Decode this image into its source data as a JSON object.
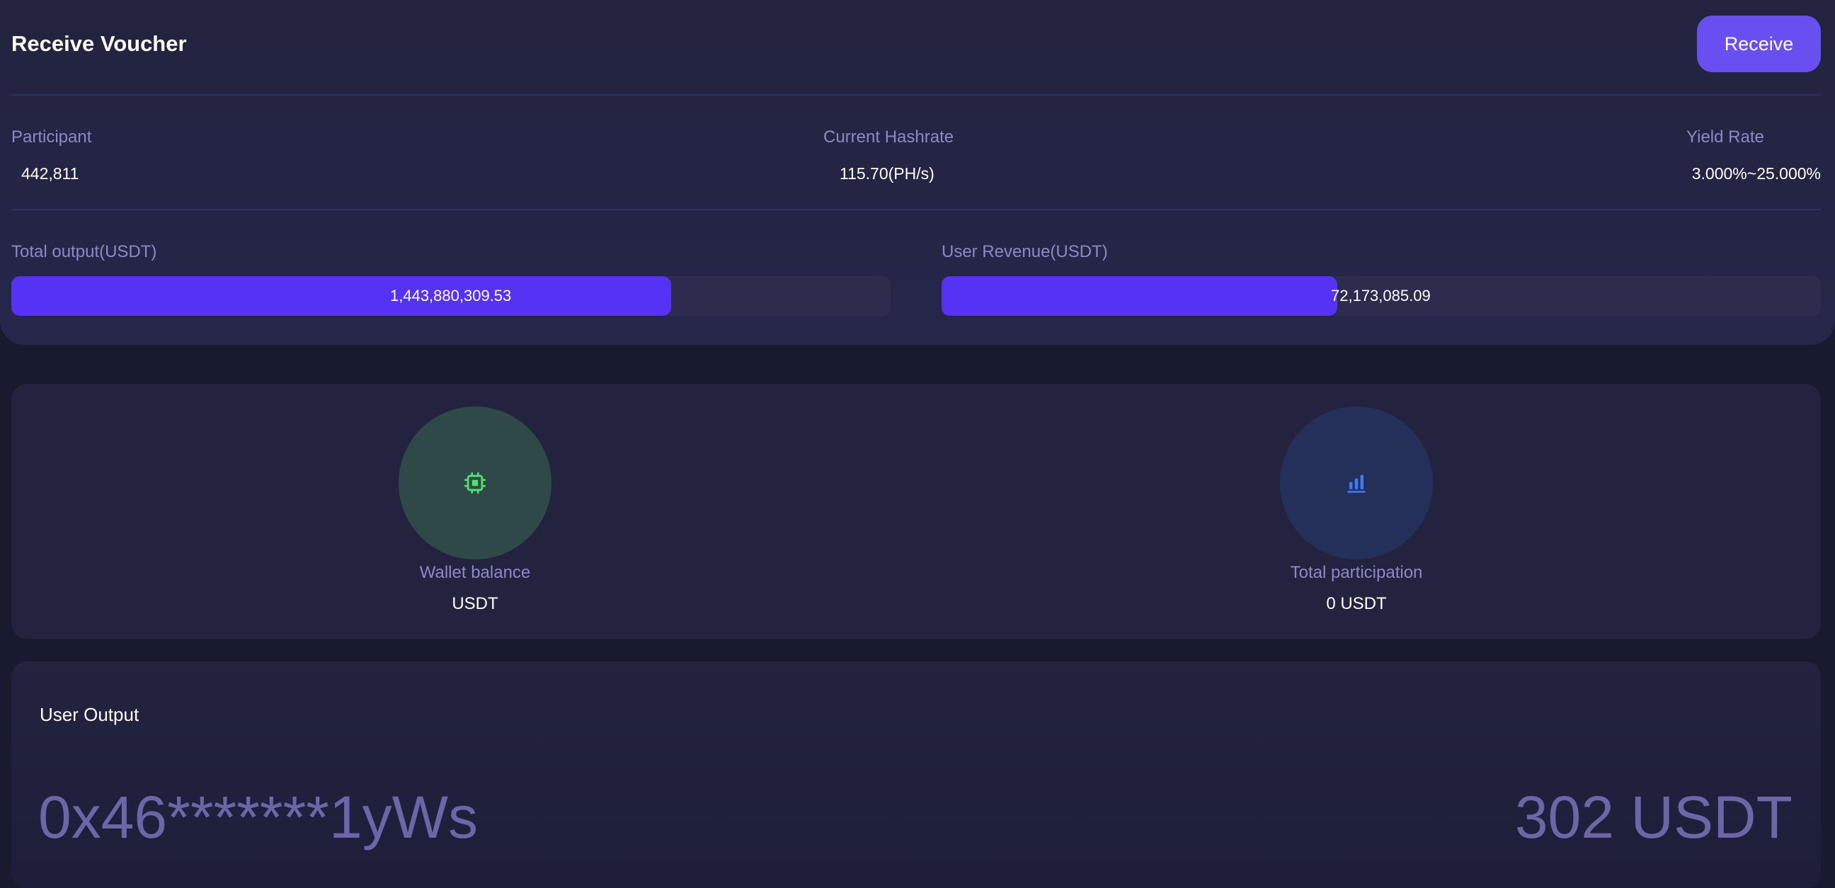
{
  "header": {
    "title": "Receive Voucher",
    "receive_label": "Receive"
  },
  "stats": {
    "participant_label": "Participant",
    "participant_value": "442,811",
    "hashrate_label": "Current Hashrate",
    "hashrate_value": "115.70(PH/s)",
    "yield_label": "Yield Rate",
    "yield_value": "3.000%~25.000%"
  },
  "progress": {
    "total_output_label": "Total output(USDT)",
    "total_output_value": "1,443,880,309.53",
    "total_output_fill_fraction": 0.75,
    "user_revenue_label": "User Revenue(USDT)",
    "user_revenue_value": "72,173,085.09",
    "user_revenue_fill_fraction": 0.45
  },
  "balances": {
    "wallet_label": "Wallet balance",
    "wallet_value": "USDT",
    "wallet_icon": "chip-icon",
    "participation_label": "Total participation",
    "participation_value": "0 USDT",
    "participation_icon": "bar-chart-icon"
  },
  "output": {
    "title": "User Output",
    "address": "0x46*******1yWs",
    "amount": "302 USDT"
  },
  "colors": {
    "accent": "#6a4ff0",
    "progress_fill": "#5632f5",
    "chip_icon": "#4ee36a",
    "chart_icon": "#3f7cf5"
  }
}
